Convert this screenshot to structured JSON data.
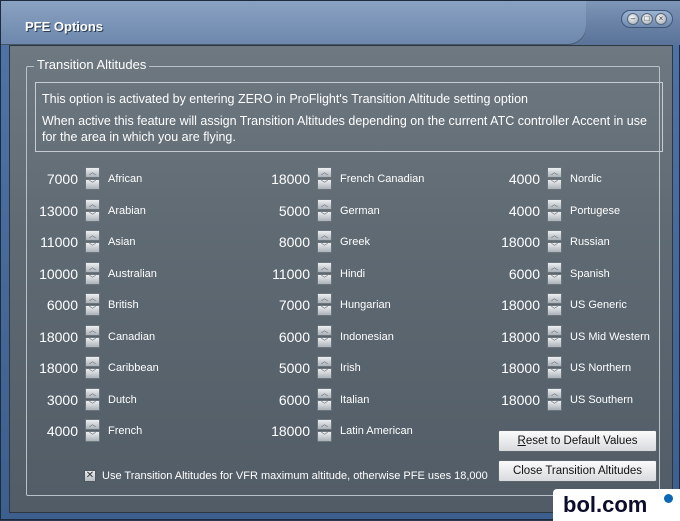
{
  "window": {
    "title": "PFE Options"
  },
  "group": {
    "label": "Transition Altitudes"
  },
  "info": {
    "line1": "This option is activated by entering ZERO in ProFlight's Transition Altitude setting option",
    "line2": "When active this feature will assign Transition Altitudes depending on the current ATC controller Accent in use for the area in which you are flying."
  },
  "columns": [
    [
      {
        "value": "7000",
        "label": "African"
      },
      {
        "value": "13000",
        "label": "Arabian"
      },
      {
        "value": "11000",
        "label": "Asian"
      },
      {
        "value": "10000",
        "label": "Australian"
      },
      {
        "value": "6000",
        "label": "British"
      },
      {
        "value": "18000",
        "label": "Canadian"
      },
      {
        "value": "18000",
        "label": "Caribbean"
      },
      {
        "value": "3000",
        "label": "Dutch"
      },
      {
        "value": "4000",
        "label": "French"
      }
    ],
    [
      {
        "value": "18000",
        "label": "French Canadian"
      },
      {
        "value": "5000",
        "label": "German"
      },
      {
        "value": "8000",
        "label": "Greek"
      },
      {
        "value": "11000",
        "label": "Hindi"
      },
      {
        "value": "7000",
        "label": "Hungarian"
      },
      {
        "value": "6000",
        "label": "Indonesian"
      },
      {
        "value": "5000",
        "label": "Irish"
      },
      {
        "value": "6000",
        "label": "Italian"
      },
      {
        "value": "18000",
        "label": "Latin American"
      }
    ],
    [
      {
        "value": "4000",
        "label": "Nordic"
      },
      {
        "value": "4000",
        "label": "Portugese"
      },
      {
        "value": "18000",
        "label": "Russian"
      },
      {
        "value": "6000",
        "label": "Spanish"
      },
      {
        "value": "18000",
        "label": "US Generic"
      },
      {
        "value": "18000",
        "label": "US Mid Western"
      },
      {
        "value": "18000",
        "label": "US Northern"
      },
      {
        "value": "18000",
        "label": "US Southern"
      }
    ]
  ],
  "buttons": {
    "reset": "Reset to Default Values",
    "close": "Close Transition Altitudes"
  },
  "vfr_option": {
    "label": "Use Transition Altitudes for VFR maximum altitude, otherwise PFE uses 18,000",
    "checked": true
  },
  "watermark": "bol.com"
}
